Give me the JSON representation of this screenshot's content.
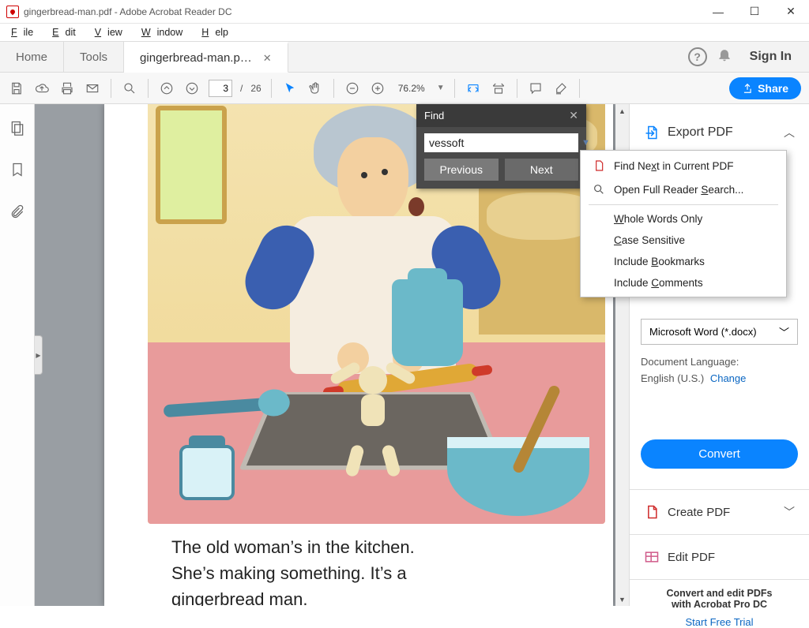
{
  "window": {
    "title": "gingerbread-man.pdf - Adobe Acrobat Reader DC"
  },
  "menus": {
    "file_h": "F",
    "file_t": "ile",
    "edit_h": "E",
    "edit_t": "dit",
    "view_h": "V",
    "view_t": "iew",
    "window_h": "W",
    "window_t": "indow",
    "help_h": "H",
    "help_t": "elp"
  },
  "tabs": {
    "home": "Home",
    "tools": "Tools",
    "doc": "gingerbread-man.p…",
    "signin": "Sign In"
  },
  "toolbar": {
    "page_current": "3",
    "page_sep": "/",
    "page_total": "26",
    "zoom": "76.2%",
    "share": "Share"
  },
  "story": {
    "line1": "The old woman’s in the kitchen.",
    "line2": "She’s making something. It’s a",
    "line3": "gingerbread man."
  },
  "find": {
    "title": "Find",
    "value": "vessoft",
    "prev": "Previous",
    "next": "Next",
    "menu_findnext_pre": "Find Ne",
    "menu_findnext_u": "x",
    "menu_findnext_post": "t in Current PDF",
    "menu_fullsearch_pre": "Open Full Reader ",
    "menu_fullsearch_u": "S",
    "menu_fullsearch_post": "earch...",
    "menu_whole_u": "W",
    "menu_whole_post": "hole Words Only",
    "menu_case_u": "C",
    "menu_case_post": "ase Sensitive",
    "menu_bookmarks_pre": "Include ",
    "menu_bookmarks_u": "B",
    "menu_bookmarks_post": "ookmarks",
    "menu_comments_pre": "Include ",
    "menu_comments_u": "C",
    "menu_comments_post": "omments"
  },
  "rightpanel": {
    "export": "Export PDF",
    "format_value": "Microsoft Word (*.docx)",
    "lang_label": "Document Language:",
    "lang_value": "English (U.S.)",
    "lang_change": "Change",
    "convert": "Convert",
    "create": "Create PDF",
    "edit": "Edit PDF",
    "foot1": "Convert and edit PDFs",
    "foot2": "with Acrobat Pro DC",
    "trial": "Start Free Trial"
  }
}
